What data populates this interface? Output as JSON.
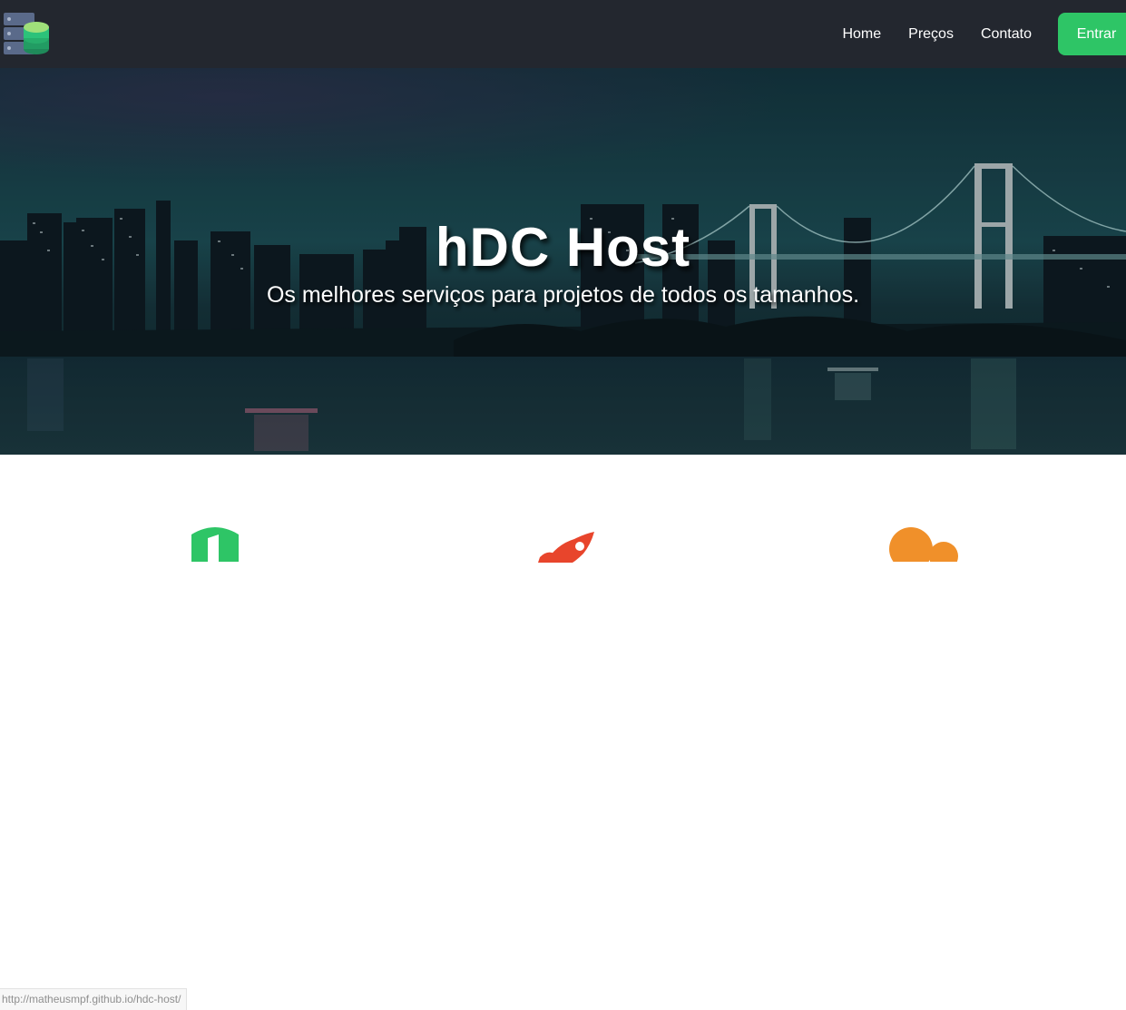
{
  "navbar": {
    "logo_icon": "database-server-icon",
    "links": [
      "Home",
      "Preços",
      "Contato"
    ],
    "login_label": "Entrar",
    "accent_color": "#2ec566",
    "background_color": "#23272f"
  },
  "hero": {
    "title": "hDC Host",
    "subtitle": "Os melhores serviços para projetos de todos os tamanhos.",
    "background": "night-city-bridge-photo"
  },
  "features": {
    "icons": [
      {
        "name": "shield-icon",
        "color": "#2ec566"
      },
      {
        "name": "rocket-icon",
        "color": "#e8452c"
      },
      {
        "name": "users-icon",
        "color": "#f0902a"
      }
    ]
  },
  "status_bar": {
    "url": "http://matheusmpf.github.io/hdc-host/"
  }
}
